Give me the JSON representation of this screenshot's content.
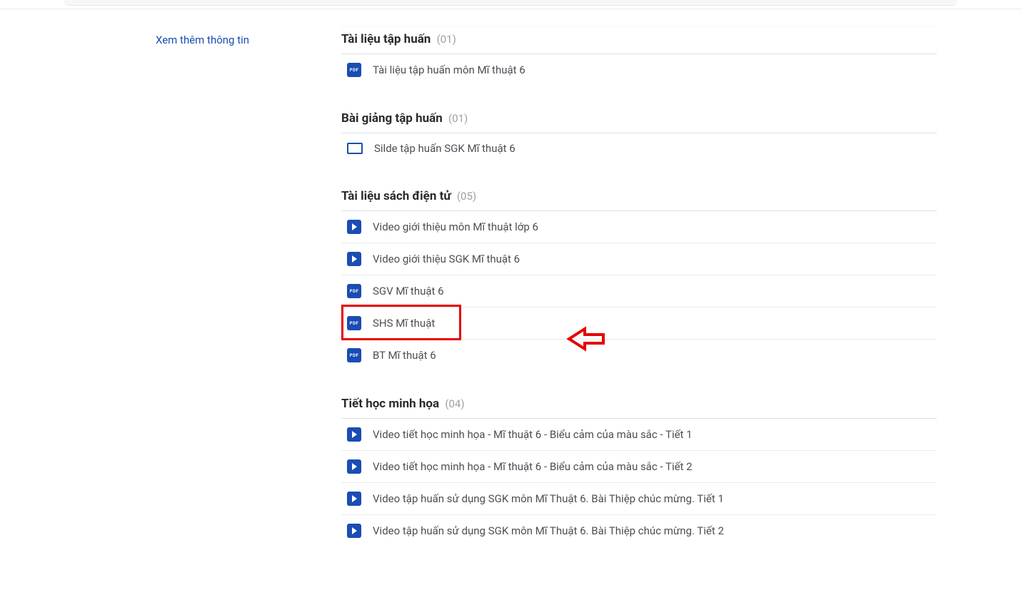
{
  "sidebar": {
    "see_more": "Xem thêm thông tin"
  },
  "sections": [
    {
      "heading": "Tài liệu tập huấn",
      "count": "(01)",
      "items": [
        {
          "icon": "pdf",
          "title": "Tài liệu tập huấn môn Mĩ thuật 6"
        }
      ]
    },
    {
      "heading": "Bài giảng tập huấn",
      "count": "(01)",
      "items": [
        {
          "icon": "slide",
          "title": "Silde tập huấn SGK Mĩ thuật 6"
        }
      ]
    },
    {
      "heading": "Tài liệu sách điện tử",
      "count": "(05)",
      "items": [
        {
          "icon": "video",
          "title": "Video giới thiệu môn Mĩ thuật lớp 6"
        },
        {
          "icon": "video",
          "title": "Video giới thiệu SGK Mĩ thuật 6"
        },
        {
          "icon": "pdf",
          "title": "SGV Mĩ thuật 6"
        },
        {
          "icon": "pdf",
          "title": "SHS Mĩ thuật",
          "highlight": true
        },
        {
          "icon": "pdf",
          "title": "BT Mĩ thuật 6"
        }
      ]
    },
    {
      "heading": "Tiết học minh họa",
      "count": "(04)",
      "items": [
        {
          "icon": "video",
          "title": "Video tiết học minh họa - Mĩ thuật 6 - Biểu cảm của màu sắc - Tiết 1"
        },
        {
          "icon": "video",
          "title": "Video tiết học minh họa - Mĩ thuật 6 - Biểu cảm của màu sắc - Tiết 2"
        },
        {
          "icon": "video",
          "title": "Video tập huấn sử dụng SGK môn Mĩ Thuật 6. Bài Thiệp chúc mừng. Tiết 1"
        },
        {
          "icon": "video",
          "title": "Video tập huấn sử dụng SGK môn Mĩ Thuật 6. Bài Thiệp chúc mừng. Tiết 2"
        }
      ]
    }
  ],
  "icons": {
    "pdf_label": "PDF"
  }
}
